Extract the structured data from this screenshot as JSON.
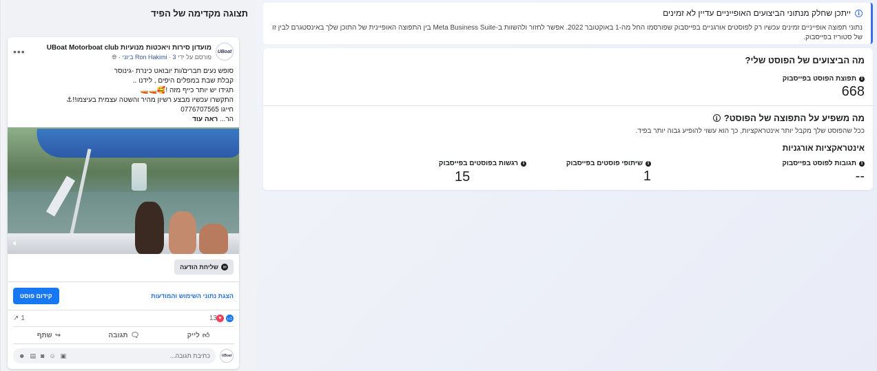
{
  "notice": {
    "title": "ייתכן שחלק מנתוני הביצועים האופייניים עדיין לא זמינים",
    "body": "נתוני תפוצה אופייניים זמינים עכשיו רק לפוסטים אורגניים בפייסבוק שפורסמו החל מה-1 באוקטובר 2022. אפשר לחזור ולהשוות ב-Meta Business Suite בין התפוצה האופיינית של התוכן שלך באינסטגרם לבין זו של סטוריז בפייסבוק."
  },
  "performance": {
    "heading": "מה הביצועים של הפוסט שלי?",
    "reach_label": "תפוצת הפוסט בפייסבוק",
    "reach_value": "668"
  },
  "factors": {
    "heading": "מה משפיע על התפוצה של הפוסט?",
    "subtitle": "ככל שהפוסט שלך מקבל יותר אינטראקציות, כך הוא עשוי להופיע גבוה יותר בפיד.",
    "interactions_heading": "אינטראקציות אורגניות",
    "metrics": [
      {
        "label": "תגובות לפוסט בפייסבוק",
        "value": "--"
      },
      {
        "label": "שיתופי פוסטים בפייסבוק",
        "value": "1"
      },
      {
        "label": "רגשות בפוסטים בפייסבוק",
        "value": "15"
      }
    ]
  },
  "preview": {
    "title": "תצוגה מקדימה של הפיד",
    "page_name": "מועדון סירות ויאכטות מנועיות UBoat Motorboat club",
    "byline_prefix": "פורסם על ידי",
    "author": "Ron Hakimi",
    "date": "3 ביוני",
    "avatar_text": "UBoat",
    "text_lines": [
      "סופש נעים חברים/ות יובואט כינרת -גינוסר",
      "קבלת שבת במפלים היפים , לידנו ..",
      "תגידו יש יותר כייף מזה !🥰🚤🚤",
      "התקשרו עכשיו מבצע רשיון מהיר והשטה עצמית בעיצמו!!⚓",
      "חייגו 0776707565"
    ],
    "see_more_prefix": "הר...",
    "see_more": "ראה עוד",
    "message_button": "שליחת הודעה",
    "boost_button": "קידום פוסט",
    "insights_link": "הצגת נתוני השימוש והמודעות",
    "reactions_count": "13",
    "shares_count": "1",
    "like": "לייק",
    "comment": "תגובה",
    "share": "שתף",
    "comment_placeholder": "כתיבת תגובה..."
  }
}
